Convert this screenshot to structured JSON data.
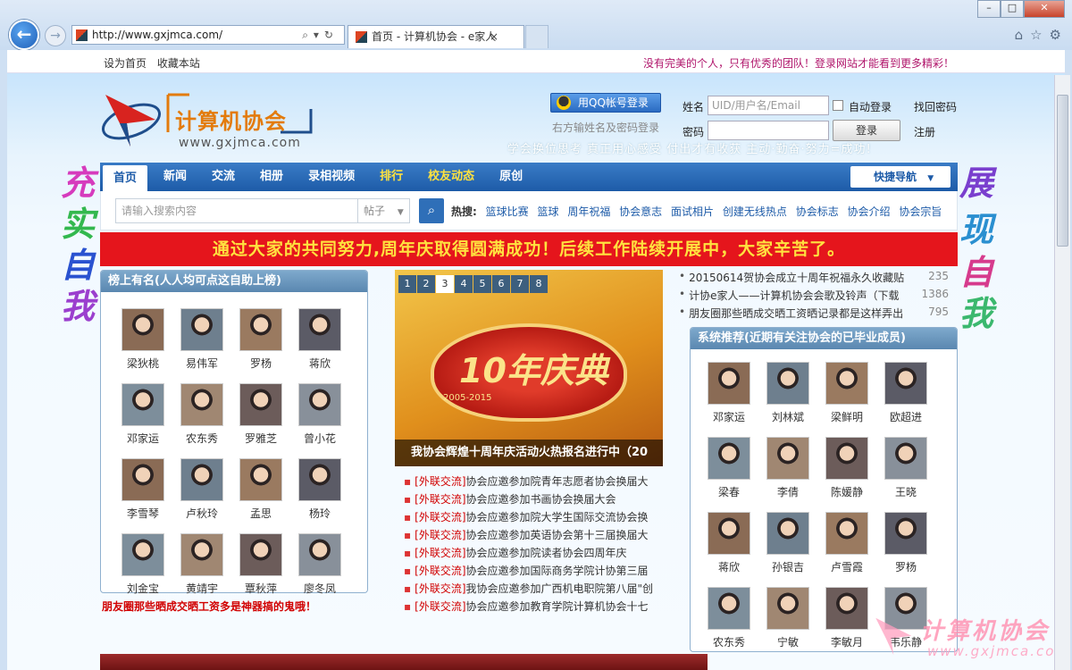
{
  "browser": {
    "address": "http://www.gxjmca.com/",
    "tab_title": "首页 - 计算机协会 - e家人",
    "tab_close": "×"
  },
  "topbar": {
    "set_home": "设为首页",
    "bookmark": "收藏本站",
    "notice": "没有完美的个人，只有优秀的团队！登录网站才能看到更多精彩！"
  },
  "logo": {
    "name": "计算机协会",
    "url": "www.gxjmca.com"
  },
  "login": {
    "qq_label": "用QQ帐号登录",
    "qq_hint": "右方输姓名及密码登录",
    "name_label": "姓名",
    "name_placeholder": "UID/用户名/Email",
    "auto_login": "自动登录",
    "find_password": "找回密码",
    "password_label": "密码",
    "login_button": "登录",
    "register": "注册"
  },
  "slogan": "学会换位思考     真正用心感受     付出才有收获     主动·勤奋·努力=成功!",
  "side_left": [
    "充",
    "实",
    "自",
    "我"
  ],
  "side_right": [
    "展",
    "现",
    "自",
    "我"
  ],
  "nav": {
    "items": [
      "首页",
      "新闻",
      "交流",
      "相册",
      "录相视频",
      "排行",
      "校友动态",
      "原创"
    ],
    "quick": "快捷导航"
  },
  "search": {
    "placeholder": "请输入搜索内容",
    "type": "帖子",
    "hot_label": "热搜:",
    "hot": [
      "篮球比赛",
      "篮球",
      "周年祝福",
      "协会意志",
      "面试相片",
      "创建无线热点",
      "协会标志",
      "协会介绍",
      "协会宗旨"
    ]
  },
  "banner": "通过大家的共同努力,周年庆取得圆满成功！后续工作陆续开展中，大家辛苦了。",
  "left_panel": {
    "title": "榜上有名(人人均可点这自助上榜)",
    "people": [
      "梁狄桃",
      "易伟军",
      "罗杨",
      "蒋欣",
      "邓家运",
      "农东秀",
      "罗雅芝",
      "曾小花",
      "李雪琴",
      "卢秋玲",
      "孟思",
      "杨玲",
      "刘金宝",
      "黄靖宇",
      "覃秋萍",
      "廖冬凤"
    ]
  },
  "left_footer": "朋友圈那些晒成交晒工资多是神器搞的鬼哦！",
  "carousel": {
    "pages": [
      "1",
      "2",
      "3",
      "4",
      "5",
      "6",
      "7",
      "8"
    ],
    "active_page": "3",
    "badge_text": "10年庆典",
    "badge_years": "2005-2015",
    "caption": "我协会辉煌十周年庆活动火热报名进行中（20"
  },
  "news": {
    "tag": "[外联交流]",
    "items": [
      "协会应邀参加院青年志愿者协会换届大",
      "协会应邀参加书画协会换届大会",
      "协会应邀参加院大学生国际交流协会换",
      "协会应邀参加英语协会第十三届换届大",
      "协会应邀参加院读者协会四周年庆",
      "协会应邀参加国际商务学院计协第三届",
      "我协会应邀参加广西机电职院第八届\"创",
      "协会应邀参加教育学院计算机协会十七"
    ]
  },
  "top_list": [
    {
      "title": "20150614贺协会成立十周年祝福永久收藏贴（",
      "count": "235"
    },
    {
      "title": "计协e家人——计算机协会会歌及铃声（下载",
      "count": "1386"
    },
    {
      "title": "朋友圈那些晒成交晒工资晒记录都是这样弄出",
      "count": "795"
    }
  ],
  "right_panel": {
    "title": "系统推荐(近期有关注协会的已毕业成员)",
    "people": [
      "邓家运",
      "刘林斌",
      "梁鲜明",
      "欧超进",
      "梁春",
      "李倩",
      "陈媛静",
      "王晓",
      "蒋欣",
      "孙银吉",
      "卢雪霞",
      "罗杨",
      "农东秀",
      "宁敏",
      "李敏月",
      "韦乐静"
    ]
  },
  "watermark": {
    "name": "计算机协会",
    "url": "www.gxjmca.com"
  },
  "colors": {
    "nav": "#2c6bb8",
    "banner": "#e5151c",
    "banner_text": "#ffe23f",
    "panel_header": "#6d98be"
  }
}
